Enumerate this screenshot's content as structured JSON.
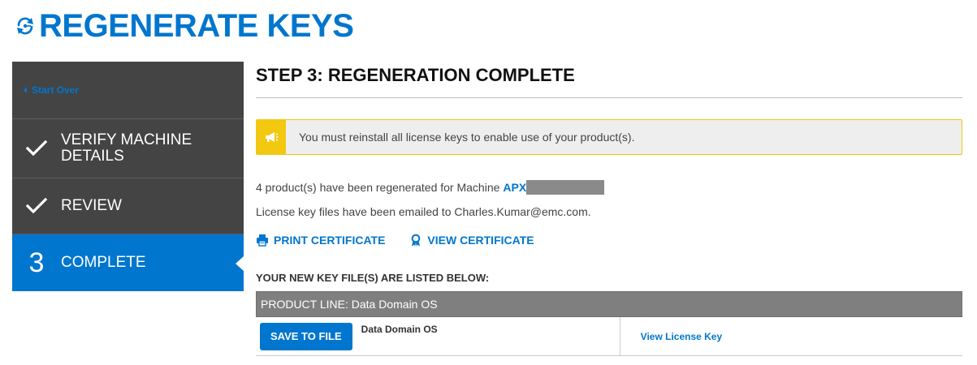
{
  "header": {
    "title": "REGENERATE KEYS",
    "icon": "refresh-key-icon"
  },
  "sidebar": {
    "start_over": "Start Over",
    "steps": [
      {
        "marker": "check",
        "label": "VERIFY MACHINE DETAILS",
        "state": "done"
      },
      {
        "marker": "check",
        "label": "REVIEW",
        "state": "done"
      },
      {
        "marker": "3",
        "label": "COMPLETE",
        "state": "active"
      }
    ]
  },
  "main": {
    "step_title": "STEP 3: REGENERATION COMPLETE",
    "alert": {
      "icon": "megaphone-icon",
      "text": "You must reinstall all license keys to enable use of your product(s)."
    },
    "regen_text": "4 product(s) have been regenerated for Machine",
    "machine_id": "APX",
    "email_text": "License key files have been emailed to Charles.Kumar@emc.com.",
    "print_certificate": "PRINT CERTIFICATE",
    "view_certificate": "VIEW CERTIFICATE",
    "list_title": "YOUR NEW KEY FILE(S) ARE LISTED BELOW:",
    "key_table": {
      "header": "PRODUCT LINE: Data Domain OS",
      "rows": [
        {
          "button": "SAVE TO FILE",
          "product": "Data Domain OS",
          "link": "View License Key"
        }
      ]
    }
  },
  "colors": {
    "brand_blue": "#0076CE",
    "sidebar_dark": "#444444",
    "alert_yellow": "#F2C811",
    "table_header_gray": "#7F7F7F"
  }
}
